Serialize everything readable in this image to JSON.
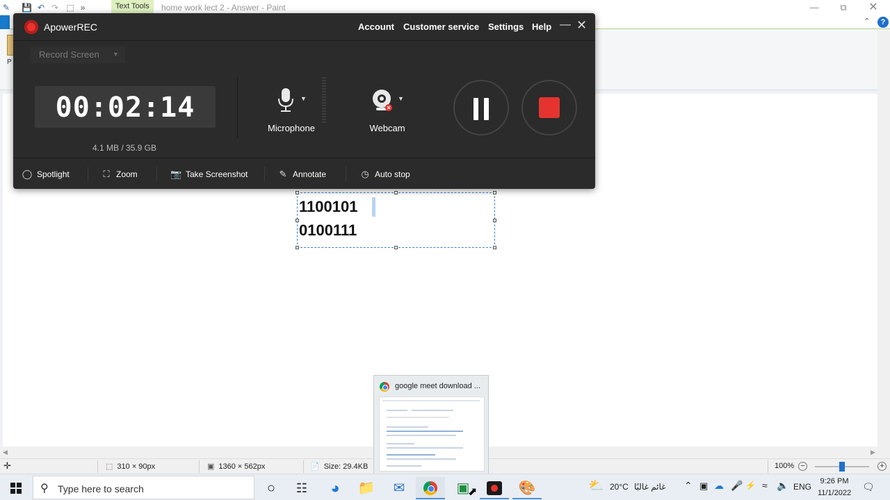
{
  "paint": {
    "window_title": "home work lect 2 - Answer - Paint",
    "context_tab": "Text Tools",
    "ribbon_letter": "P",
    "help_symbol": "?",
    "canvas_text": [
      "1100101",
      "0100111"
    ],
    "status": {
      "selection_size": "310 × 90px",
      "image_size": "1360 × 562px",
      "file_size": "Size: 29.4KB",
      "zoom": "100%"
    }
  },
  "recorder": {
    "app_title": "ApowerREC",
    "menu": [
      "Account",
      "Customer service",
      "Settings",
      "Help"
    ],
    "mode": "Record Screen",
    "timer": "00:02:14",
    "size_info": "4.1 MB / 35.9 GB",
    "sources": {
      "microphone_label": "Microphone",
      "webcam_label": "Webcam"
    },
    "tools": [
      "Spotlight",
      "Zoom",
      "Take Screenshot",
      "Annotate",
      "Auto stop"
    ]
  },
  "chrome_preview": {
    "title": "google meet download ..."
  },
  "taskbar": {
    "search_placeholder": "Type here to search",
    "weather_temp": "20°C",
    "weather_text": "غائم غالبًا",
    "language": "ENG",
    "time": "9:26 PM",
    "date": "11/1/2022"
  },
  "colors": {
    "recorder_bg": "#2b2b2b",
    "record_red": "#e5342f",
    "selection_blue": "#3b7fc4"
  }
}
